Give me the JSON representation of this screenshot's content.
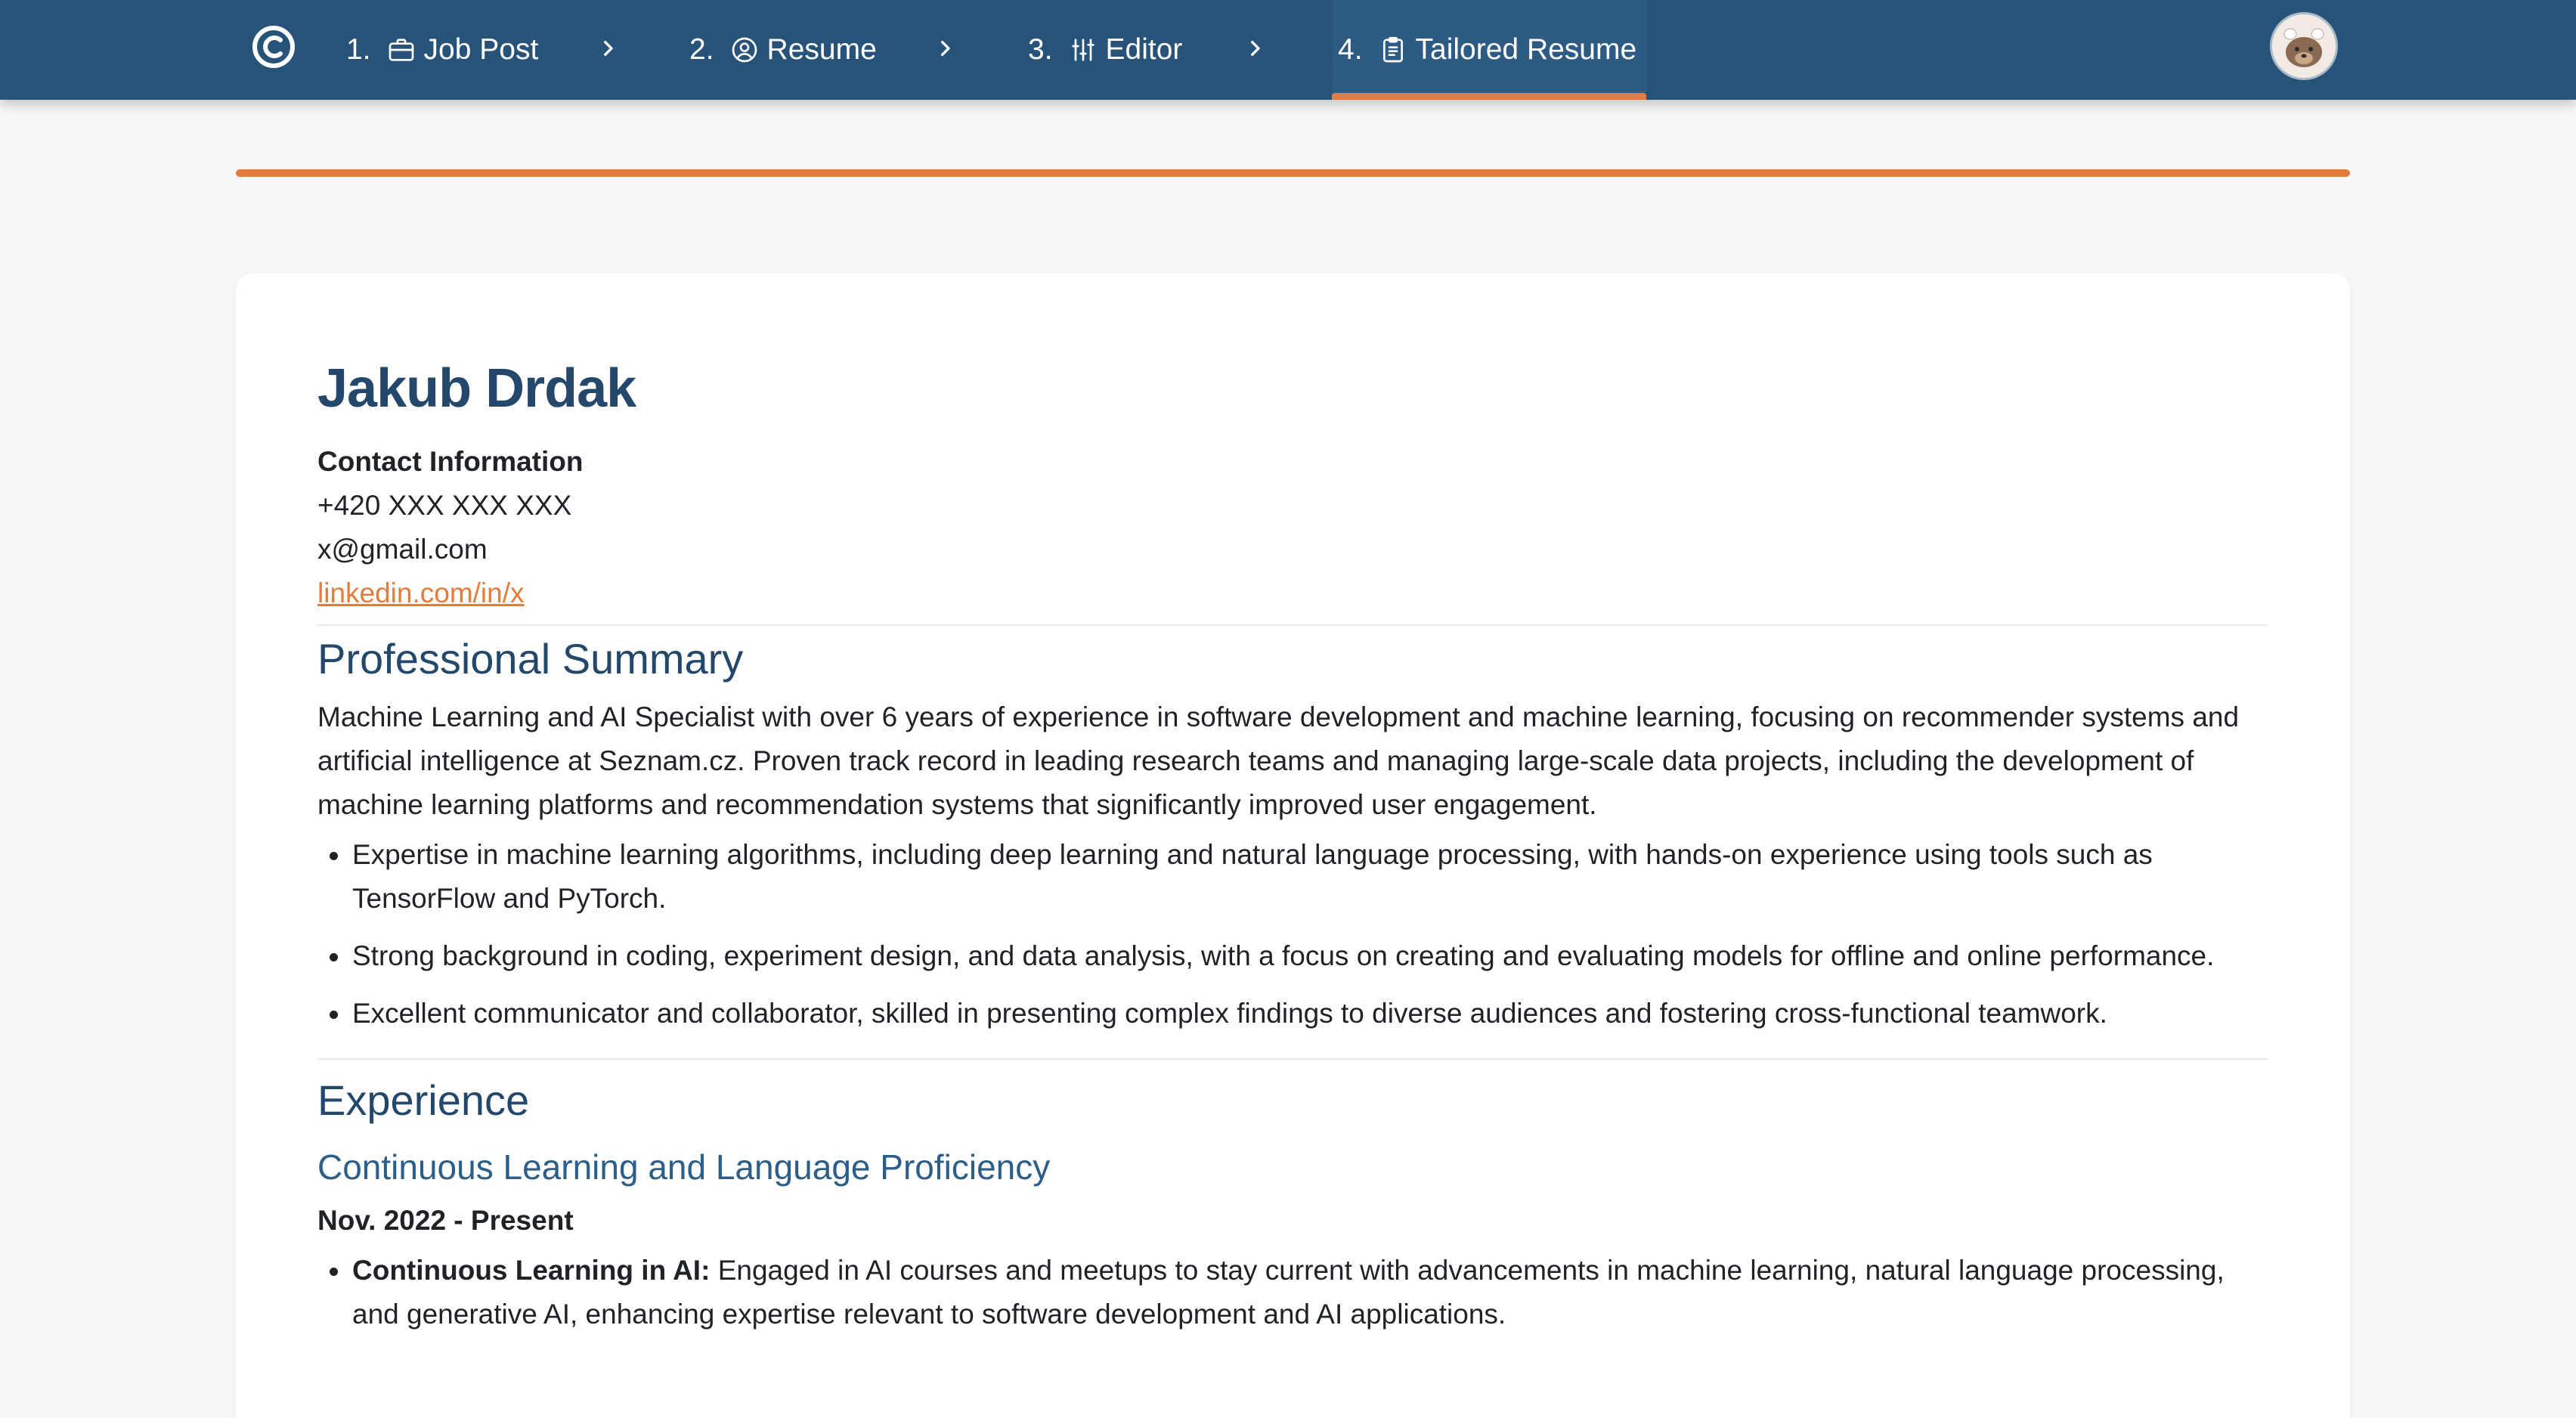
{
  "nav": {
    "steps": [
      {
        "num": "1.",
        "label": "Job Post",
        "icon": "briefcase-icon"
      },
      {
        "num": "2.",
        "label": "Resume",
        "icon": "user-circle-icon"
      },
      {
        "num": "3.",
        "label": "Editor",
        "icon": "sliders-icon"
      },
      {
        "num": "4.",
        "label": "Tailored Resume",
        "icon": "clipboard-icon",
        "active": true
      }
    ]
  },
  "progress": {
    "fraction": 1.0,
    "color": "#e47c3e"
  },
  "colors": {
    "primary": "#285379",
    "accent": "#e47c3e",
    "heading": "#23486b"
  },
  "resume": {
    "name": "Jakub Drdak",
    "contact": {
      "label": "Contact Information",
      "phone": "+420 XXX XXX XXX",
      "email": "x@gmail.com",
      "linkedin": "linkedin.com/in/x"
    },
    "summary": {
      "title": "Professional Summary",
      "paragraph": "Machine Learning and AI Specialist with over 6 years of experience in software development and machine learning, focusing on recommender systems and artificial intelligence at Seznam.cz. Proven track record in leading research teams and managing large-scale data projects, including the development of machine learning platforms and recommendation systems that significantly improved user engagement.",
      "bullets": [
        "Expertise in machine learning algorithms, including deep learning and natural language processing, with hands-on experience using tools such as TensorFlow and PyTorch.",
        "Strong background in coding, experiment design, and data analysis, with a focus on creating and evaluating models for offline and online performance.",
        "Excellent communicator and collaborator, skilled in presenting complex findings to diverse audiences and fostering cross-functional teamwork."
      ]
    },
    "experience": {
      "title": "Experience",
      "jobs": [
        {
          "title": "Continuous Learning and Language Proficiency",
          "date": "Nov. 2022 - Present",
          "bullets": [
            {
              "lead": "Continuous Learning in AI:",
              "text": " Engaged in AI courses and meetups to stay current with advancements in machine learning, natural language processing, and generative AI, enhancing expertise relevant to software development and AI applications."
            }
          ]
        }
      ]
    }
  }
}
